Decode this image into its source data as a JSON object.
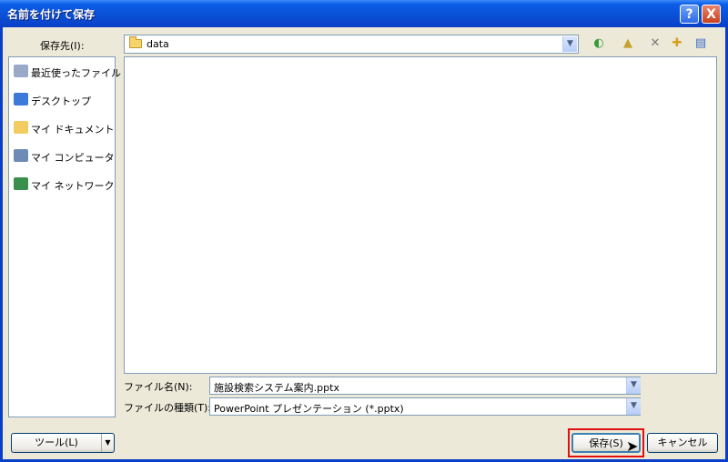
{
  "window": {
    "title": "名前を付けて保存",
    "help_label": "?",
    "close_label": "X"
  },
  "toolbar": {
    "save_in_label": "保存先(I):",
    "save_in_value": "data",
    "back_glyph": "◐",
    "up_glyph": "▲",
    "delete_glyph": "✕",
    "new_folder_glyph": "✚",
    "views_glyph": "▤"
  },
  "places": [
    {
      "label": "最近使ったファイル",
      "icon": "recent-docs-icon",
      "color": "#9aa9c8"
    },
    {
      "label": "デスクトップ",
      "icon": "desktop-icon",
      "color": "#3d79d8"
    },
    {
      "label": "マイ ドキュメント",
      "icon": "my-documents-icon",
      "color": "#f2cc60"
    },
    {
      "label": "マイ コンピュータ",
      "icon": "my-computer-icon",
      "color": "#6e8bb8"
    },
    {
      "label": "マイ ネットワーク",
      "icon": "my-network-icon",
      "color": "#3b8f4c"
    }
  ],
  "fields": {
    "filename_label": "ファイル名(N):",
    "filename_value": "施設検索システム案内.pptx",
    "filetype_label": "ファイルの種類(T):",
    "filetype_value": "PowerPoint プレゼンテーション (*.pptx)"
  },
  "buttons": {
    "tools_label": "ツール(L)",
    "tools_arrow": "▼",
    "save_label": "保存(S)",
    "cancel_label": "キャンセル"
  },
  "colors": {
    "highlight": "#e01010",
    "titlebar": "#0a4fd4"
  }
}
